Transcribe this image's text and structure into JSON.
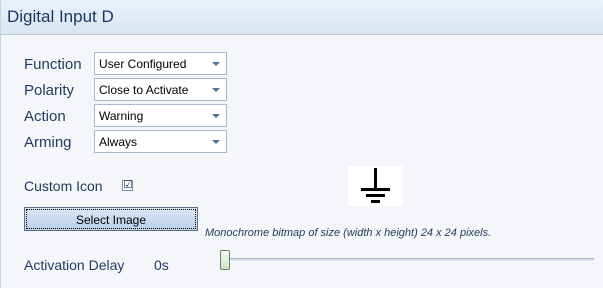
{
  "title": "Digital Input D",
  "fields": [
    {
      "label": "Function",
      "value": "User Configured"
    },
    {
      "label": "Polarity",
      "value": "Close to Activate"
    },
    {
      "label": "Action",
      "value": "Warning"
    },
    {
      "label": "Arming",
      "value": "Always"
    }
  ],
  "custom_icon": {
    "label": "Custom Icon",
    "checked": true,
    "check_glyph": "☑",
    "icon_name": "earth-ground-icon"
  },
  "select_image": {
    "label": "Select Image",
    "hint": "Monochrome bitmap of size (width x height) 24 x 24 pixels."
  },
  "activation_delay": {
    "label": "Activation Delay",
    "value_text": "0s",
    "value": 0
  },
  "colors": {
    "title_text": "#17375e",
    "label_text": "#1f3a5f",
    "panel_bg": "#f4f6f9"
  }
}
